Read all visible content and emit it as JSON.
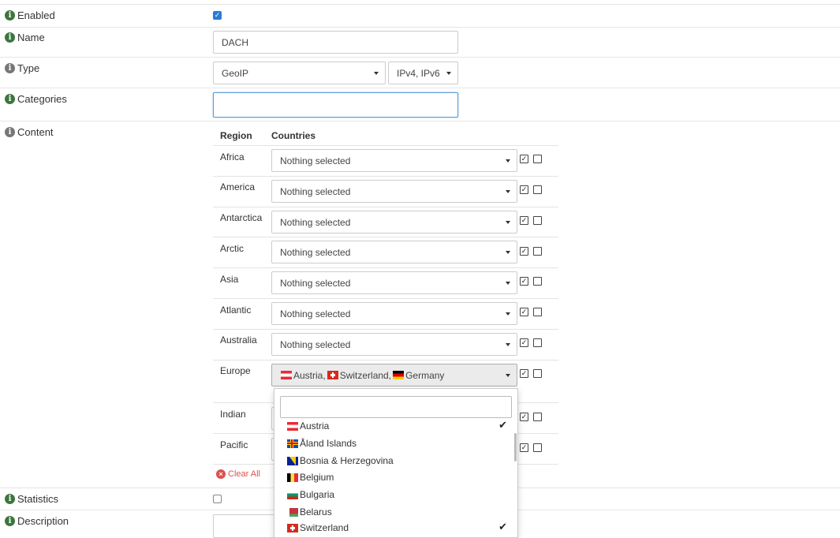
{
  "form": {
    "enabled": {
      "label": "Enabled",
      "checked": true
    },
    "name": {
      "label": "Name",
      "value": "DACH"
    },
    "type": {
      "label": "Type",
      "value": "GeoIP",
      "protocol": "IPv4, IPv6"
    },
    "categories": {
      "label": "Categories",
      "value": ""
    },
    "content": {
      "label": "Content"
    },
    "statistics": {
      "label": "Statistics",
      "checked": false
    },
    "description": {
      "label": "Description"
    }
  },
  "content_table": {
    "headers": {
      "region": "Region",
      "countries": "Countries"
    },
    "rows": [
      {
        "region": "Africa",
        "countries": "Nothing selected"
      },
      {
        "region": "America",
        "countries": "Nothing selected"
      },
      {
        "region": "Antarctica",
        "countries": "Nothing selected"
      },
      {
        "region": "Arctic",
        "countries": "Nothing selected"
      },
      {
        "region": "Asia",
        "countries": "Nothing selected"
      },
      {
        "region": "Atlantic",
        "countries": "Nothing selected"
      },
      {
        "region": "Australia",
        "countries": "Nothing selected"
      },
      {
        "region": "Europe",
        "countries": "Austria, Switzerland, Germany"
      },
      {
        "region": "Indian",
        "countries": ""
      },
      {
        "region": "Pacific",
        "countries": ""
      }
    ],
    "europe_selected": [
      {
        "name": "Austria",
        "flag": "at"
      },
      {
        "name": "Switzerland",
        "flag": "ch"
      },
      {
        "name": "Germany",
        "flag": "de"
      }
    ],
    "clear_all": "Clear All"
  },
  "europe_dropdown": {
    "search_value": "",
    "items": [
      {
        "name": "Austria",
        "flag": "at",
        "selected": true
      },
      {
        "name": "Åland Islands",
        "flag": "ax",
        "selected": false
      },
      {
        "name": "Bosnia & Herzegovina",
        "flag": "ba",
        "selected": false
      },
      {
        "name": "Belgium",
        "flag": "be",
        "selected": false
      },
      {
        "name": "Bulgaria",
        "flag": "bg",
        "selected": false
      },
      {
        "name": "Belarus",
        "flag": "by",
        "selected": false
      },
      {
        "name": "Switzerland",
        "flag": "ch",
        "selected": true
      }
    ]
  },
  "colors": {
    "accent": "#2b7bd6",
    "info_green": "#3c763d",
    "danger": "#d9534f"
  }
}
